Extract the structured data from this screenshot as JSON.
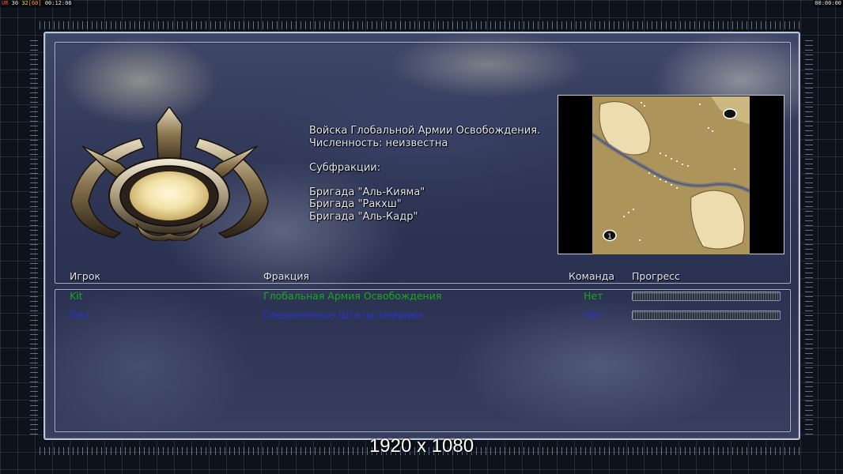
{
  "debug": {
    "ur_label": "UR",
    "fps_value": "30",
    "fps_avg": "32",
    "fps_max": "[60]",
    "clock_left": "00:12:06",
    "clock_right": "00:00:00"
  },
  "faction_info": {
    "army_name": "Войска Глобальной Армии Освобождения.",
    "strength": "Численность: неизвестна",
    "subfactions_heading": "Субфракции:",
    "subfactions": [
      "Бригада \"Аль-Кияма\"",
      "Бригада \"Ракхш\"",
      "Бригада \"Аль-Кадр\""
    ]
  },
  "minimap": {
    "start_marker_1": "1",
    "terrain_color": "#a88f55",
    "sand_color": "#ecdcae",
    "river_color": "#6e7284"
  },
  "table": {
    "headers": {
      "player": "Игрок",
      "faction": "Фракция",
      "team": "Команда",
      "progress": "Прогресс"
    },
    "rows": [
      {
        "player": "Kit",
        "faction": "Глобальная Армия Освобождения",
        "team": "Нет",
        "progress": 0,
        "color": "#17a81d"
      },
      {
        "player": "Deu",
        "faction": "Соединенные Штаты Америки",
        "team": "Нет",
        "progress": 0,
        "color": "#2a33c8"
      }
    ]
  },
  "watermark": "1920 x 1080",
  "colors": {
    "panel_border": "#b8c6de",
    "text_main": "#e4e6ee"
  }
}
